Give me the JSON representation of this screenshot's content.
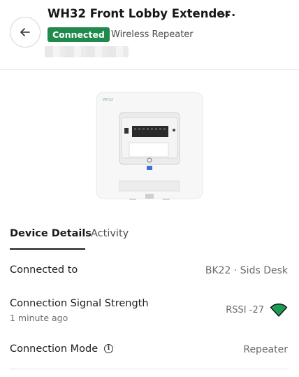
{
  "header": {
    "title": "WH32 Front Lobby Extender",
    "more_glyph": "···",
    "status_badge": "Connected",
    "device_type": "Wireless Repeater",
    "colors": {
      "status_green": "#1f8a4c",
      "signal_green": "#1a9c54"
    }
  },
  "device_image": {
    "model_label": "WH32"
  },
  "tabs": [
    {
      "label": "Device Details",
      "selected": true
    },
    {
      "label": "Activity",
      "selected": false
    }
  ],
  "details": {
    "connected_to": {
      "label": "Connected to",
      "value": "BK22 · Sids Desk"
    },
    "signal_strength": {
      "label": "Connection Signal Strength",
      "sublabel": "1 minute ago",
      "value": "RSSI -27",
      "icon": "wifi-signal-icon"
    },
    "connection_mode": {
      "label": "Connection Mode",
      "value": "Repeater",
      "icon": "info-icon",
      "info_glyph": "i"
    }
  }
}
